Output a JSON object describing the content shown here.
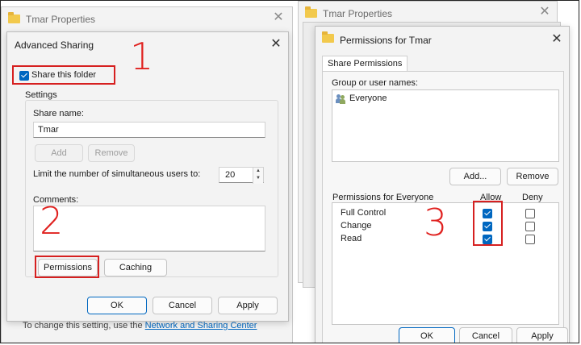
{
  "colors": {
    "accent": "#0067c0",
    "annotation_red": "#e0211f"
  },
  "tmar_properties_left": {
    "title": "Tmar Properties",
    "footer_text": "To change this setting, use the",
    "footer_link": "Network and Sharing Center"
  },
  "tmar_properties_right": {
    "title": "Tmar Properties"
  },
  "advanced_sharing": {
    "title": "Advanced Sharing",
    "share_checkbox_label": "Share this folder",
    "share_checked": true,
    "settings_group": "Settings",
    "share_name_label": "Share name:",
    "share_name_value": "Tmar",
    "add_label": "Add",
    "remove_label": "Remove",
    "limit_label": "Limit the number of simultaneous users to:",
    "limit_value": "20",
    "comments_label": "Comments:",
    "permissions_label": "Permissions",
    "caching_label": "Caching",
    "ok_label": "OK",
    "cancel_label": "Cancel",
    "apply_label": "Apply"
  },
  "permissions": {
    "title": "Permissions for Tmar",
    "tab_label": "Share Permissions",
    "group_label": "Group or user names:",
    "users": [
      "Everyone"
    ],
    "add_label": "Add...",
    "remove_label": "Remove",
    "perm_header": "Permissions for Everyone",
    "allow_header": "Allow",
    "deny_header": "Deny",
    "rows": [
      {
        "name": "Full Control",
        "allow": true,
        "deny": false
      },
      {
        "name": "Change",
        "allow": true,
        "deny": false
      },
      {
        "name": "Read",
        "allow": true,
        "deny": false
      }
    ],
    "ok_label": "OK",
    "cancel_label": "Cancel",
    "apply_label": "Apply"
  },
  "annotations": {
    "one": "1",
    "two": "2",
    "three": "3"
  }
}
